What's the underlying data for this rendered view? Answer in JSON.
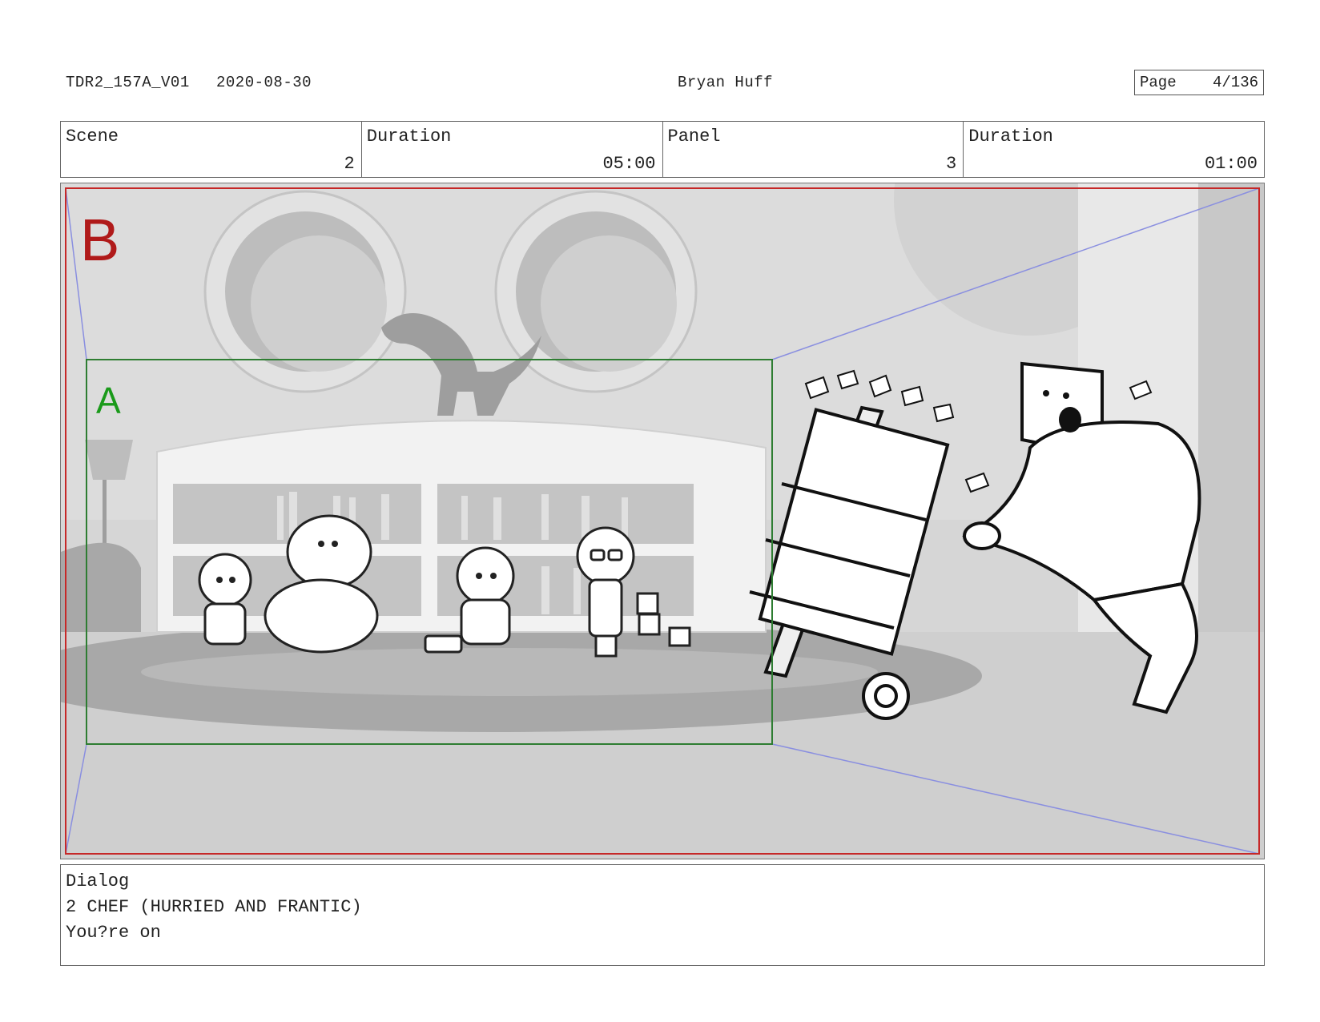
{
  "header": {
    "doc_id": "TDR2_157A_V01",
    "date": "2020-08-30",
    "artist": "Bryan Huff",
    "page_label": "Page",
    "page_value": "4/136"
  },
  "info": {
    "scene_label": "Scene",
    "scene_value": "2",
    "scene_duration_label": "Duration",
    "scene_duration_value": "05:00",
    "panel_label": "Panel",
    "panel_value": "3",
    "panel_duration_label": "Duration",
    "panel_duration_value": "01:00"
  },
  "panel": {
    "marker_b": "B",
    "marker_a": "A",
    "colors": {
      "frame_b": "#c62828",
      "frame_a": "#2e7d32",
      "camera_lines": "#8a8fe0"
    }
  },
  "dialog": {
    "label": "Dialog",
    "character": "2 CHEF (HURRIED AND FRANTIC)",
    "line": "You?re on"
  }
}
